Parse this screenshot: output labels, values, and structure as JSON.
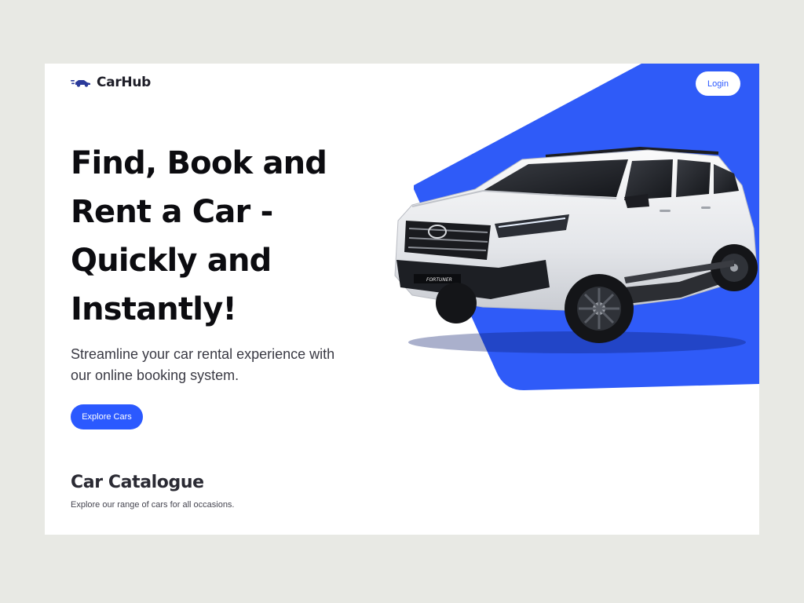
{
  "navbar": {
    "brand": "CarHub",
    "logo_icon": "car-icon",
    "login_label": "Login"
  },
  "hero": {
    "title": "Find, Book and Rent a Car - Quickly and Instantly!",
    "subtitle": "Streamline your car rental experience with our online booking system.",
    "cta_label": "Explore Cars",
    "car_badge": "FORTUNER",
    "car_image": "white-suv-image"
  },
  "catalogue": {
    "title": "Car Catalogue",
    "subtitle": "Explore our range of cars for all occasions."
  },
  "colors": {
    "accent": "#2b59ff",
    "background": "#e8e9e4",
    "surface": "#ffffff",
    "heading": "#0c0c10"
  }
}
